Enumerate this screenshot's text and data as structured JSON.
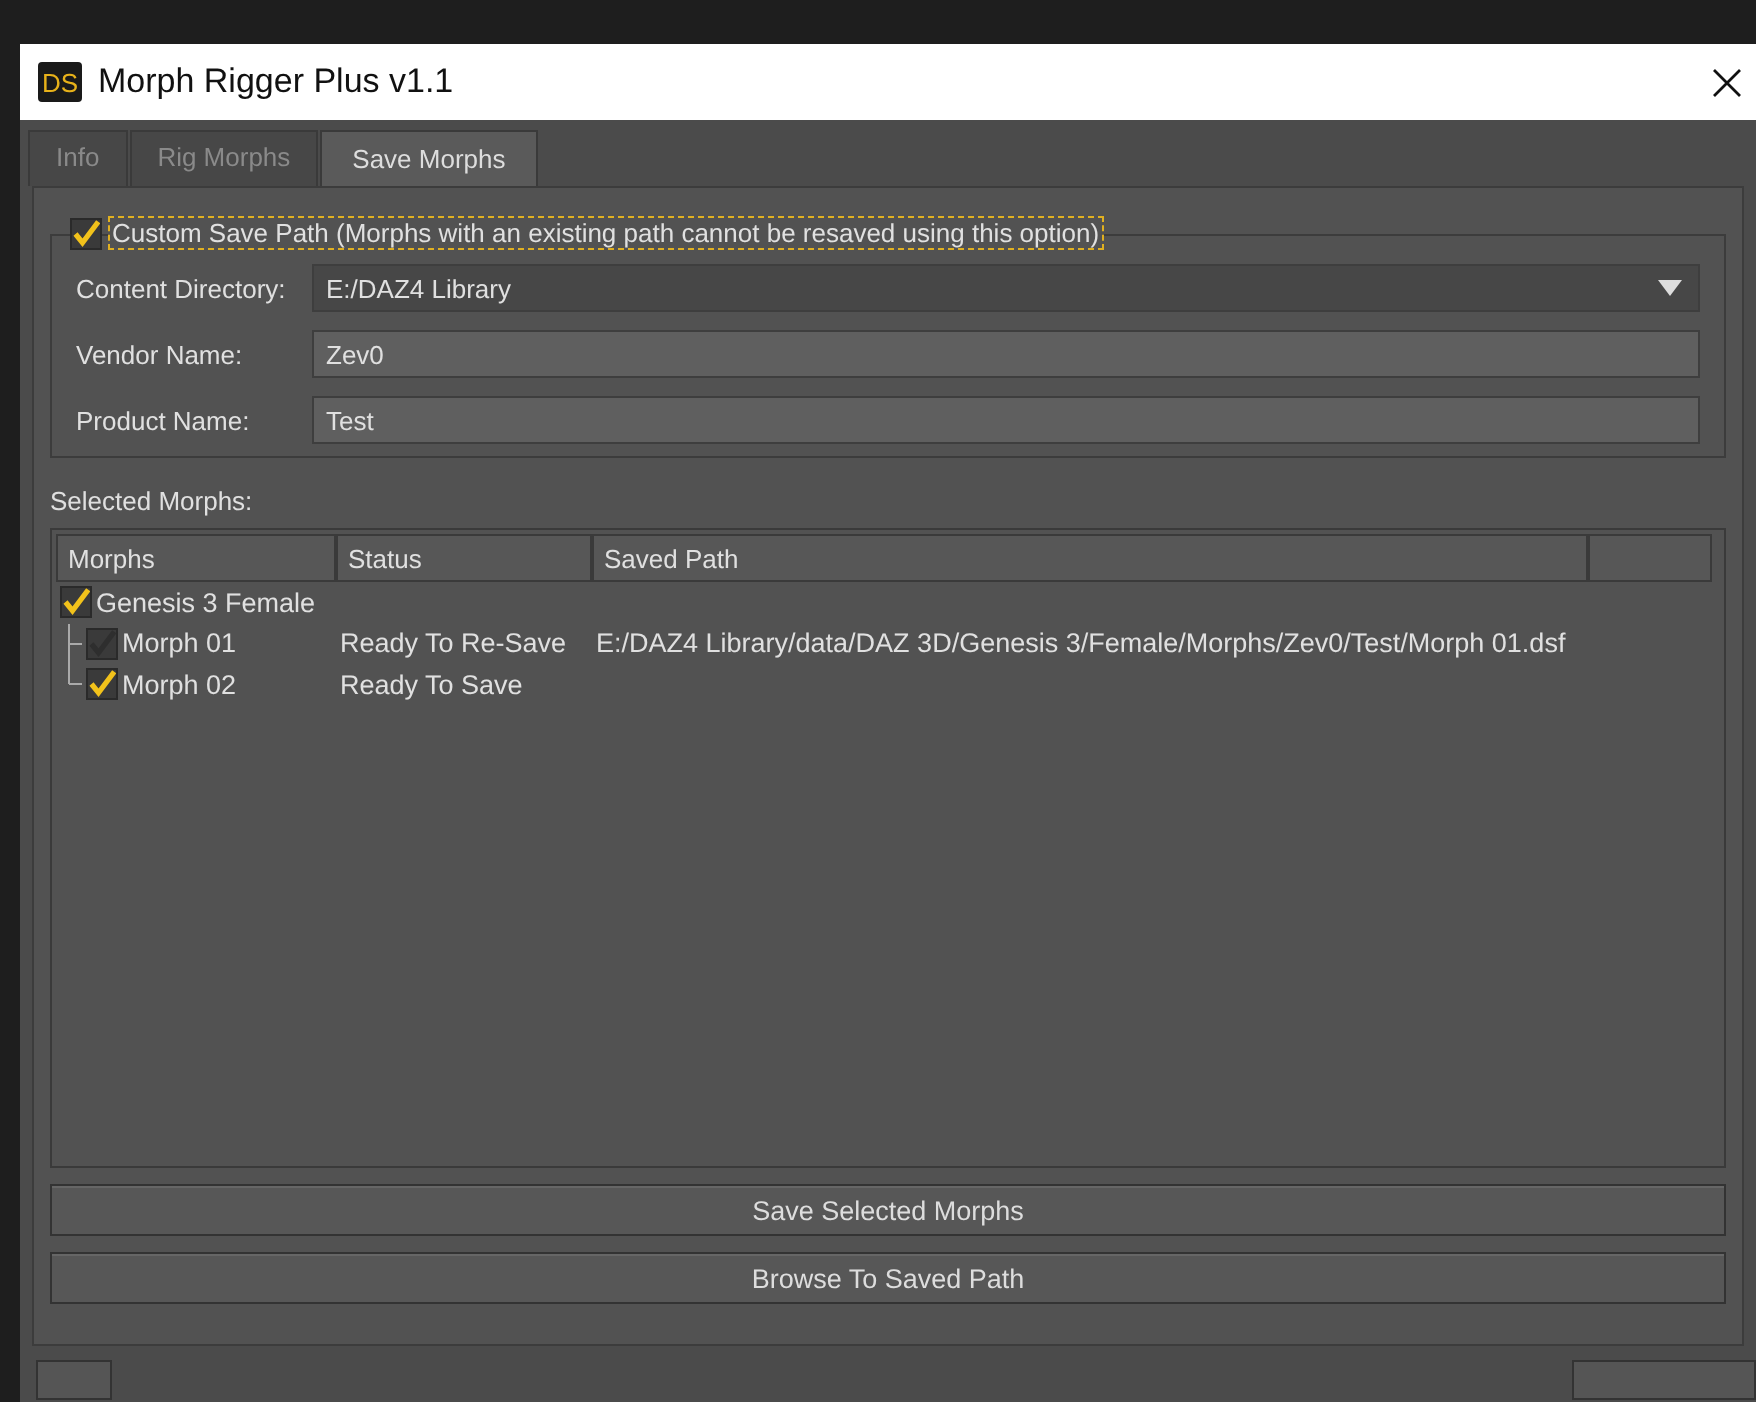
{
  "window": {
    "logo": "DS",
    "title": "Morph Rigger Plus v1.1"
  },
  "tabs": [
    {
      "label": "Info",
      "selected": false
    },
    {
      "label": "Rig Morphs",
      "selected": false
    },
    {
      "label": "Save Morphs",
      "selected": true
    }
  ],
  "custom_save_path": {
    "label": "Custom Save Path (Morphs with an existing path cannot be resaved using this option)",
    "checked": true
  },
  "fields": [
    {
      "label": "Content Directory:",
      "value": "E:/DAZ4 Library",
      "kind": "dropdown"
    },
    {
      "label": "Vendor Name:",
      "value": "Zev0",
      "kind": "text"
    },
    {
      "label": "Product Name:",
      "value": "Test",
      "kind": "text"
    }
  ],
  "selected_morphs": {
    "label": "Selected Morphs:",
    "columns": [
      "Morphs",
      "Status",
      "Saved Path"
    ],
    "rows": [
      {
        "name": "Genesis 3 Female",
        "checked": true,
        "disabled": false,
        "children": [
          {
            "name": "Morph 01",
            "status": "Ready To Re-Save",
            "saved_path": "E:/DAZ4 Library/data/DAZ 3D/Genesis 3/Female/Morphs/Zev0/Test/Morph 01.dsf",
            "checked": true,
            "disabled": true
          },
          {
            "name": "Morph 02",
            "status": "Ready To Save",
            "checked": true,
            "disabled": false
          }
        ]
      }
    ]
  },
  "buttons": [
    "Save Selected Morphs",
    "Browse To Saved Path"
  ]
}
